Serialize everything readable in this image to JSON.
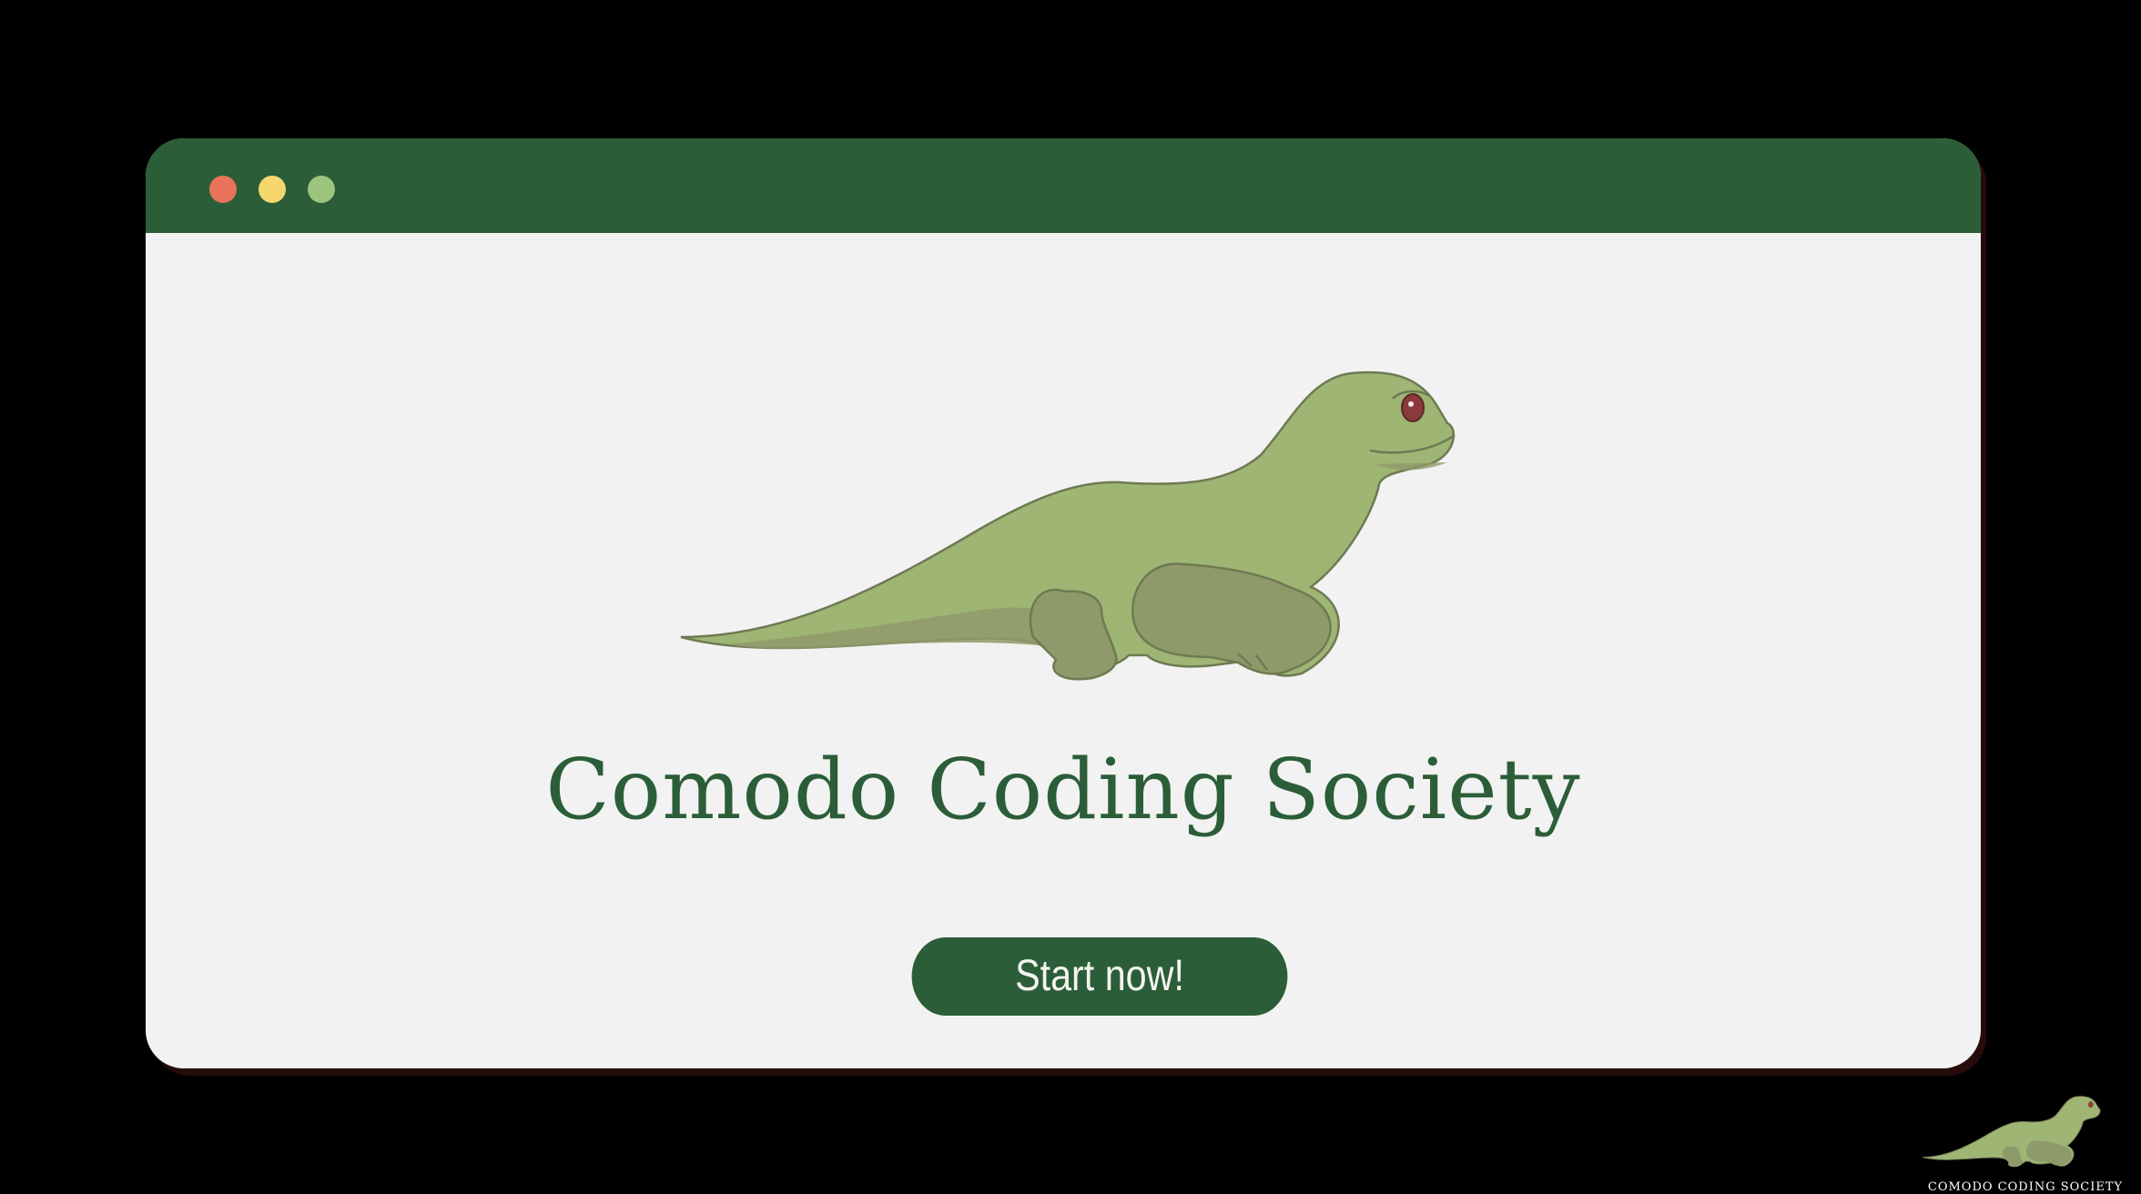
{
  "window": {
    "controls": [
      {
        "name": "close",
        "color": "#e8735a"
      },
      {
        "name": "minimize",
        "color": "#f5d76e"
      },
      {
        "name": "maximize",
        "color": "#9cc47f"
      }
    ],
    "titlebar_color": "#2b5e38"
  },
  "hero": {
    "mascot_icon": "komodo-dragon-illustration",
    "title": "Comodo Coding Society",
    "cta_label": "Start now!"
  },
  "footer_logo": {
    "icon": "komodo-dragon-logo",
    "text": "COMODO CODING SOCIETY"
  },
  "colors": {
    "background": "#000000",
    "window_body": "#f2f2f2",
    "brand_green": "#2b5e38",
    "mascot_green": "#9fb574",
    "mascot_shadow": "#8f9a6a"
  }
}
